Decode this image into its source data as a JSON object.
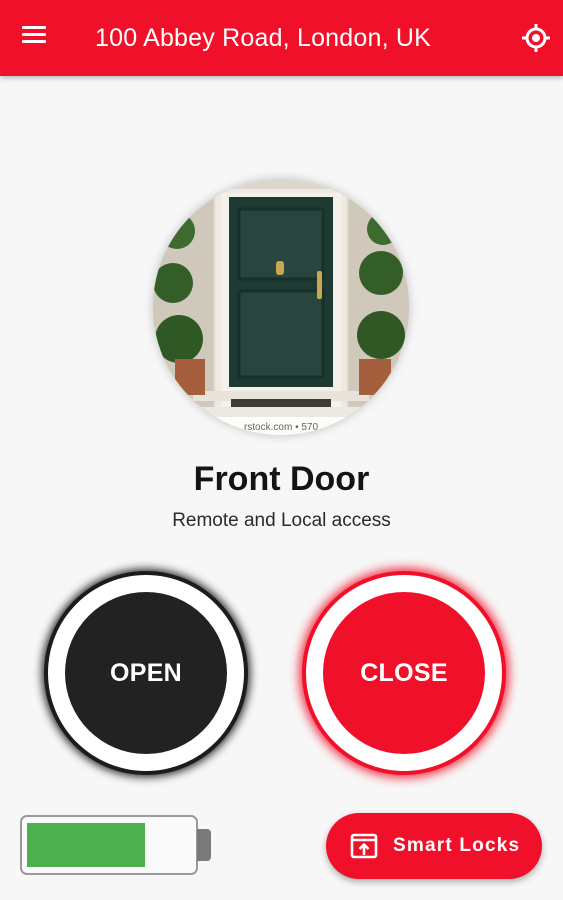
{
  "header": {
    "title": "100 Abbey Road, London, UK",
    "menu_icon": "menu-icon",
    "location_icon": "my-location-icon",
    "accent_color": "#f1102a"
  },
  "lock": {
    "name": "Front Door",
    "subtitle": "Remote and Local access",
    "photo_caption": "rstock.com • 570"
  },
  "actions": {
    "open_label": "OPEN",
    "close_label": "CLOSE",
    "open_color": "#222222",
    "close_color": "#f1102a"
  },
  "battery": {
    "level": 0.72,
    "color": "#4caf50"
  },
  "fab": {
    "label": "Smart Locks",
    "icon": "open-in-app-icon"
  }
}
